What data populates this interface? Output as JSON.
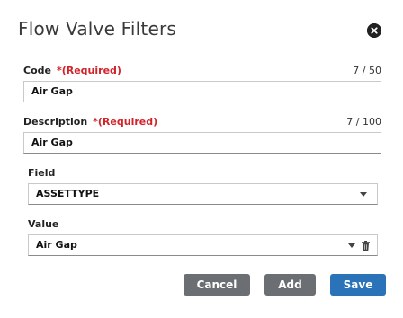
{
  "dialog": {
    "title": "Flow Valve Filters"
  },
  "code": {
    "label": "Code",
    "required": "*(Required)",
    "counter": "7 / 50",
    "value": "Air Gap"
  },
  "description": {
    "label": "Description",
    "required": "*(Required)",
    "counter": "7 / 100",
    "value": "Air Gap"
  },
  "field": {
    "label": "Field",
    "selected": "ASSETTYPE"
  },
  "value": {
    "label": "Value",
    "selected": "Air Gap"
  },
  "buttons": {
    "cancel": "Cancel",
    "add": "Add",
    "save": "Save"
  },
  "colors": {
    "required": "#d2232a",
    "save": "#2a73b8",
    "secondary": "#6b6e73"
  },
  "icons": {
    "close": "close-circle-icon",
    "dropdown": "chevron-down-icon",
    "delete": "trash-icon"
  }
}
